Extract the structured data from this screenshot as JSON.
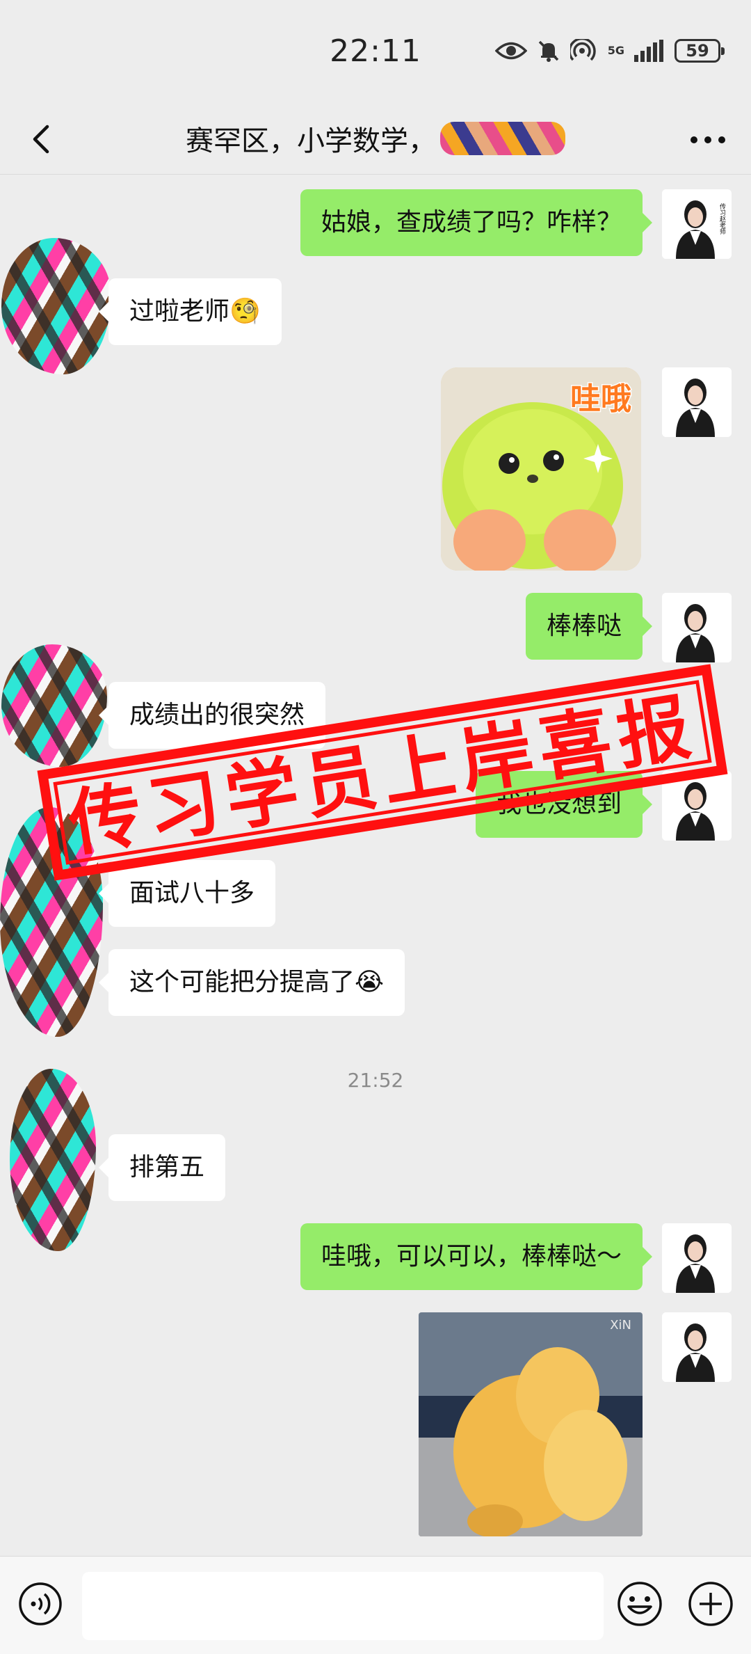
{
  "status_bar": {
    "time": "22:11",
    "network_label": "5G",
    "battery": "59"
  },
  "header": {
    "title": "赛罕区，小学数学，",
    "back_icon": "chevron-left-icon",
    "more_icon": "more-dots-icon"
  },
  "messages": [
    {
      "side": "out",
      "text": "姑娘，查成绩了吗？咋样？"
    },
    {
      "side": "in",
      "text": "过啦老师🧐"
    },
    {
      "side": "out",
      "sticker": "哇哦"
    },
    {
      "side": "out",
      "text": "棒棒哒"
    },
    {
      "side": "in",
      "text": "成绩出的很突然"
    },
    {
      "side": "out",
      "text": "我也没想到"
    },
    {
      "side": "in",
      "text": "面试八十多"
    },
    {
      "side": "in",
      "text": "这个可能把分提高了😭"
    },
    {
      "side": "in",
      "text": "排第五"
    },
    {
      "side": "out",
      "text": "哇哦，可以可以，棒棒哒～"
    }
  ],
  "timestamp": "21:52",
  "stamp": {
    "text": "传习学员上岸喜报",
    "color": "#ff1010"
  },
  "avatar_teacher": {
    "caption": "传习赵老师"
  },
  "gif_watermark": "XiN",
  "input_bar": {
    "voice_icon": "voice-icon",
    "emoji_icon": "emoji-icon",
    "plus_icon": "plus-icon"
  },
  "colors": {
    "outgoing_bubble": "#95ec69",
    "incoming_bubble": "#ffffff",
    "background": "#ededed"
  }
}
